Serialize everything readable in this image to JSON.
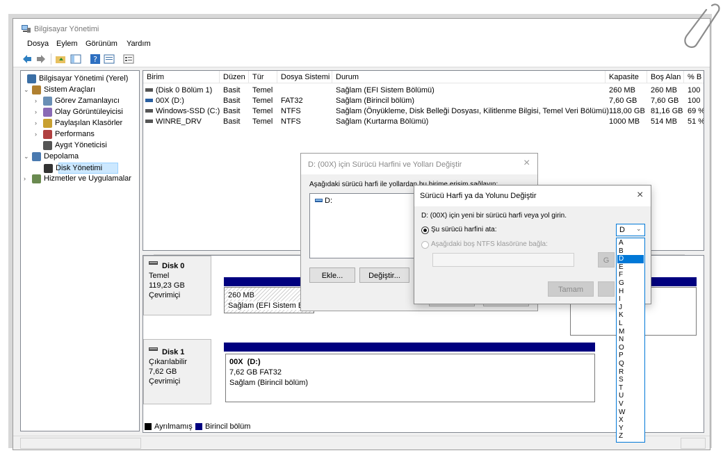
{
  "window": {
    "title": "Bilgisayar Yönetimi"
  },
  "menu": [
    "Dosya",
    "Eylem",
    "Görünüm",
    "Yardım"
  ],
  "tree": [
    {
      "label": "Bilgisayar Yönetimi (Yerel)",
      "level": 0,
      "expander": "",
      "icon": "computer-icon"
    },
    {
      "label": "Sistem Araçları",
      "level": 1,
      "expander": "v",
      "icon": "tools-icon"
    },
    {
      "label": "Görev Zamanlayıcı",
      "level": 2,
      "expander": ">",
      "icon": "clock-icon"
    },
    {
      "label": "Olay Görüntüleyicisi",
      "level": 2,
      "expander": ">",
      "icon": "event-viewer-icon"
    },
    {
      "label": "Paylaşılan Klasörler",
      "level": 2,
      "expander": ">",
      "icon": "shared-folder-icon"
    },
    {
      "label": "Performans",
      "level": 2,
      "expander": ">",
      "icon": "performance-icon"
    },
    {
      "label": "Aygıt Yöneticisi",
      "level": 2,
      "expander": "",
      "icon": "device-manager-icon"
    },
    {
      "label": "Depolama",
      "level": 1,
      "expander": "v",
      "icon": "storage-icon"
    },
    {
      "label": "Disk Yönetimi",
      "level": 2,
      "expander": "",
      "icon": "disk-management-icon",
      "selected": true
    },
    {
      "label": "Hizmetler ve Uygulamalar",
      "level": 1,
      "expander": ">",
      "icon": "services-icon"
    }
  ],
  "volumes": {
    "headers": [
      "Birim",
      "Düzen",
      "Tür",
      "Dosya Sistemi",
      "Durum",
      "Kapasite",
      "Boş Alan",
      "% B"
    ],
    "rows": [
      [
        "(Disk 0 Bölüm 1)",
        "Basit",
        "Temel",
        "",
        "Sağlam (EFI Sistem Bölümü)",
        "260 MB",
        "260 MB",
        "100"
      ],
      [
        "00X (D:)",
        "Basit",
        "Temel",
        "FAT32",
        "Sağlam (Birincil bölüm)",
        "7,60 GB",
        "7,60 GB",
        "100"
      ],
      [
        "Windows-SSD (C:)",
        "Basit",
        "Temel",
        "NTFS",
        "Sağlam (Önyükleme, Disk Belleği Dosyası, Kilitlenme Bilgisi, Temel Veri Bölümü)",
        "118,00 GB",
        "81,16 GB",
        "69 %"
      ],
      [
        "WINRE_DRV",
        "Basit",
        "Temel",
        "NTFS",
        "Sağlam (Kurtarma Bölümü)",
        "1000 MB",
        "514 MB",
        "51 %"
      ]
    ]
  },
  "disks": [
    {
      "name": "Disk 0",
      "type": "Temel",
      "size": "119,23 GB",
      "status": "Çevrimiçi",
      "partition": {
        "size": "260 MB",
        "status": "Sağlam (EFI Sistem Bölüm"
      }
    },
    {
      "name": "Disk 1",
      "type": "Çıkarılabilir",
      "size": "7,62 GB",
      "status": "Çevrimiçi",
      "partition": {
        "title": "00X  (D:)",
        "size": "7,62 GB FAT32",
        "status": "Sağlam (Birincil bölüm)"
      }
    }
  ],
  "legend": {
    "unallocated": "Ayrılmamış",
    "primary": "Birincil bölüm"
  },
  "dialog_paths": {
    "title": "D: (00X) için Sürücü Harfini ve Yolları Değiştir",
    "description": "Aşağıdaki sürücü harfi ile yollardan bu birime erişim sağlayın:",
    "entry": "D:",
    "add": "Ekle...",
    "change": "Değiştir..."
  },
  "dialog_letter": {
    "title": "Sürücü Harfi ya da Yolunu Değiştir",
    "prompt": "D: (00X) için yeni bir sürücü harfi veya yol girin.",
    "option_assign": "Şu sürücü harfini ata:",
    "option_mount": "Aşağıdaki boş NTFS klasörüne bağla:",
    "selected_letter": "D",
    "browse_partial": "G",
    "ok": "Tamam",
    "letters": [
      "A",
      "B",
      "D",
      "E",
      "F",
      "G",
      "H",
      "I",
      "J",
      "K",
      "L",
      "M",
      "N",
      "O",
      "P",
      "Q",
      "R",
      "S",
      "T",
      "U",
      "V",
      "W",
      "X",
      "Y",
      "Z"
    ]
  },
  "colors": {
    "primary_partition": "#00007f",
    "selection": "#0078d7"
  }
}
